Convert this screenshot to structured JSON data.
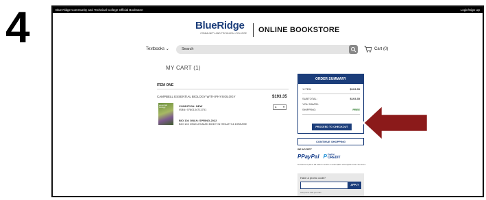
{
  "step_number": "4",
  "topbar": {
    "college_text": "Blue Ridge Community and Technical College Official Bookstore",
    "login_text": "Login/Sign Up"
  },
  "logo": {
    "brand_blue": "Blue",
    "brand_ridge": "Ridge",
    "subtext": "COMMUNITY AND TECHNICAL COLLEGE",
    "store_title": "ONLINE BOOKSTORE"
  },
  "nav": {
    "textbooks_label": "Textbooks",
    "search_placeholder": "Search",
    "cart_label": "Cart (0)"
  },
  "cart": {
    "heading": "MY CART (1)",
    "item_heading": "ITEM ONE",
    "product_name": "CAMPBELL ESSENTIAL BIOLOGY WITH PHYSIOLOGY",
    "price": "$193.35",
    "quantity": "1",
    "condition_label": "CONDITION: NEW",
    "isbn": "ISBN: 9780134711751",
    "course1": "BIO 104 ONLN: SPRING-2022",
    "course2": "BIO 104 ONLN-HUMAN BODY IN HEALTH & DISEASE",
    "book_cover_text": "essential biology"
  },
  "summary": {
    "title": "ORDER SUMMARY",
    "items_label": "1 ITEM",
    "items_value": "$193.35",
    "subtotal_label": "SUBTOTAL:",
    "subtotal_value": "$193.35",
    "saved_label": "YOU SAVED:",
    "saved_value": "",
    "shipping_label": "SHIPPING:",
    "shipping_value": "FREE",
    "checkout_label": "PROCEED TO CHECKOUT"
  },
  "continue_label": "CONTINUE SHOPPING",
  "payment": {
    "we_accept": "WE ACCEPT",
    "paypal": "PayPal",
    "paypal_credit_top": "PayPal",
    "paypal_credit": "CREDIT",
    "note": "No Interest if paid in full within 6 months on orders $99+ with PayPal Credit. See terms."
  },
  "promo": {
    "question": "Have a promo code?",
    "apply_label": "APPLY",
    "note": "One promo code per order."
  },
  "colors": {
    "brand_navy": "#1b3d7a",
    "arrow_red": "#8b1a1a",
    "free_green": "#2a7a2a"
  }
}
